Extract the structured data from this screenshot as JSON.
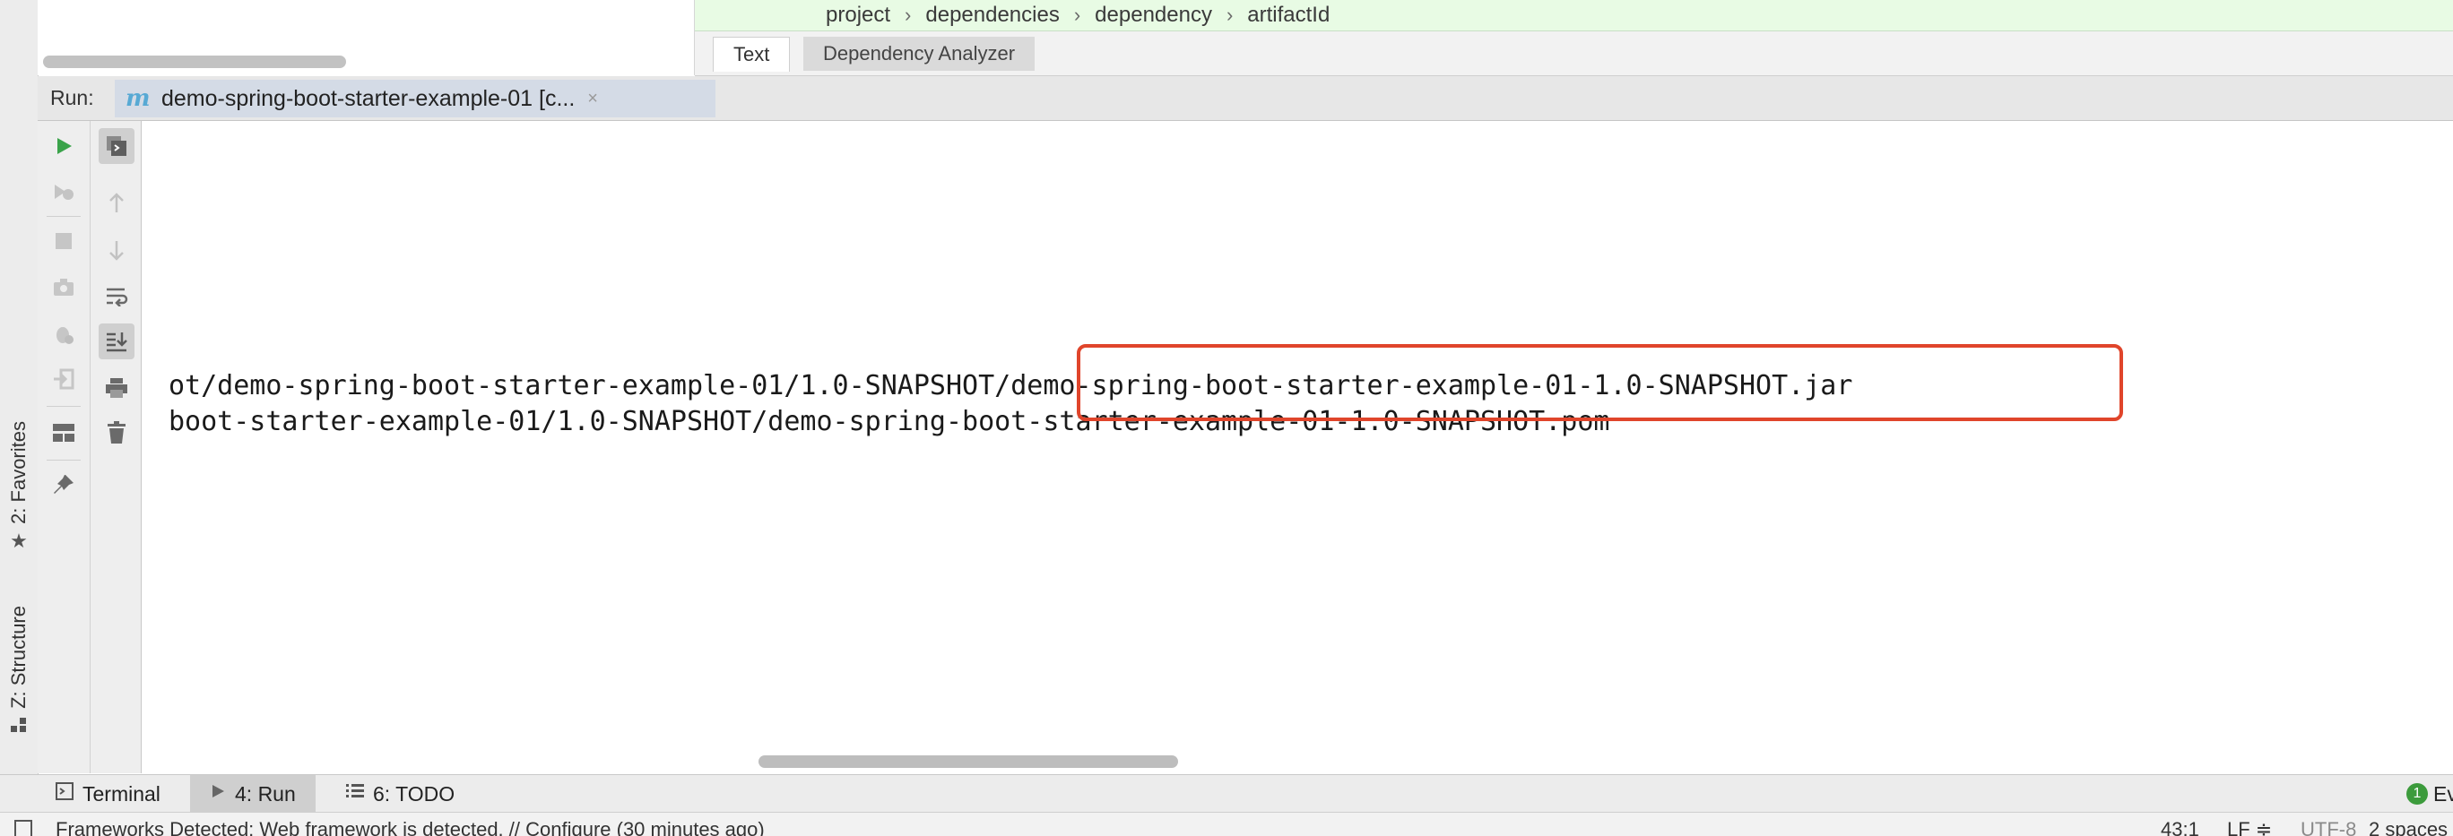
{
  "left_strip": {
    "favorites_label": "2: Favorites",
    "structure_label": "Z: Structure",
    "favorites_icon": "star-icon",
    "structure_icon": "structure-icon"
  },
  "breadcrumb": [
    "project",
    "dependencies",
    "dependency",
    "artifactId"
  ],
  "breadcrumb_separator": "›",
  "editor_tabs": {
    "text": "Text",
    "dependency_analyzer": "Dependency Analyzer"
  },
  "run_panel": {
    "label": "Run:",
    "tab_title": "demo-spring-boot-starter-example-01 [c...",
    "tab_icon_glyph": "m",
    "close_glyph": "×"
  },
  "console": {
    "lines": [
      "ot/demo-spring-boot-starter-example-01/1.0-SNAPSHOT/demo-spring-boot-starter-example-01-1.0-SNAPSHOT.jar",
      "boot-starter-example-01/1.0-SNAPSHOT/demo-spring-boot-starter-example-01-1.0-SNAPSHOT.pom"
    ]
  },
  "bottom_tabs": {
    "terminal": "Terminal",
    "run": "4: Run",
    "todo": "6: TODO",
    "event_badge": "1",
    "event_label": "Ev"
  },
  "status_bar": {
    "message": "Frameworks Detected: Web framework is detected. // Configure (30 minutes ago)",
    "position": "43:1",
    "line_sep": "LF ≑",
    "encoding": "UTF-8",
    "indent": "2 spaces"
  },
  "colors": {
    "accent_green": "#3c9b3c",
    "highlight_red": "#e0452b",
    "breadcrumb_bg": "#e8fbe4",
    "run_tab_bg": "#d4dbe6"
  }
}
